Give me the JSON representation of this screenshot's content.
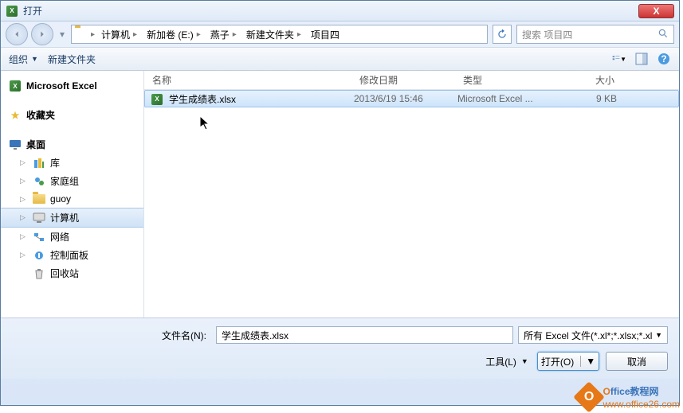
{
  "window": {
    "title": "打开",
    "close_label": "X"
  },
  "breadcrumb": {
    "items": [
      "计算机",
      "新加卷 (E:)",
      "燕子",
      "新建文件夹",
      "项目四"
    ]
  },
  "search": {
    "placeholder": "搜索 项目四"
  },
  "toolbar": {
    "organize": "组织",
    "new_folder": "新建文件夹"
  },
  "sidebar": {
    "excel": "Microsoft Excel",
    "favorites": "收藏夹",
    "desktop": "桌面",
    "libraries": "库",
    "homegroup": "家庭组",
    "user": "guoy",
    "computer": "计算机",
    "network": "网络",
    "control_panel": "控制面板",
    "recycle_bin": "回收站"
  },
  "columns": {
    "name": "名称",
    "modified": "修改日期",
    "type": "类型",
    "size": "大小"
  },
  "files": [
    {
      "name": "学生成绩表.xlsx",
      "modified": "2013/6/19 15:46",
      "type": "Microsoft Excel ...",
      "size": "9 KB"
    }
  ],
  "footer": {
    "filename_label": "文件名(N):",
    "filename_value": "学生成绩表.xlsx",
    "filter": "所有 Excel 文件(*.xl*;*.xlsx;*.xl",
    "tools": "工具(L)",
    "open": "打开(O)",
    "cancel": "取消"
  },
  "watermark": {
    "brand1": "ffice",
    "brand2": "教程网",
    "url": "www.office26.com"
  }
}
